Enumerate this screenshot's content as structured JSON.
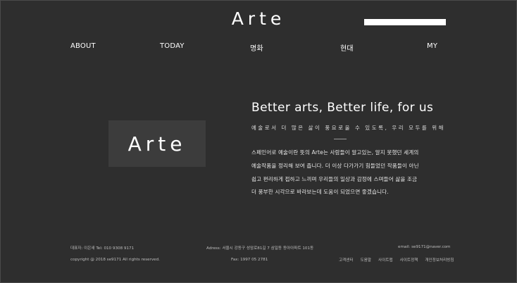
{
  "header": {
    "logo_text": "Arte",
    "search": {
      "value": "",
      "placeholder": ""
    }
  },
  "nav": {
    "items": [
      {
        "label": "ABOUT"
      },
      {
        "label": "TODAY"
      },
      {
        "label": "명화"
      },
      {
        "label": "현대"
      },
      {
        "label": "MY"
      }
    ]
  },
  "hero": {
    "brand_text": "Arte",
    "headline": "Better arts, Better life, for us",
    "subline": "예술로서 더 많은 삶이 풍요로울 수 있도록, 우리 모두를 위해",
    "description": [
      "스페인어로 예술이란 뜻의 Arte는 사람들이 알고있는, 알지 못했던 세계의",
      "예술작품을 정리해 보여 줍니다. 더 이상 다가가기 힘들었던 작품들이 아닌",
      "쉽고 편리하게 접하고 느끼며 우리들의 일상과 감정에 스며들어 삶을 조금",
      "더 풍부한 시각으로 바라보는데 도움이 되었으면 좋겠습니다."
    ]
  },
  "footer": {
    "contact": "대표자: 이은새     Tel: 010 9308 9171",
    "address": "Adress: 서울시 강동구 성암로81길 7 삼일동 동아아파트 101동",
    "email": "email: se9171@naver.com",
    "copyright": "copyright @ 2018 se9171 All rights reserved.",
    "fax": "Fax: 1997 05 2781",
    "links": [
      "고객센터",
      "도움말",
      "사이트맵",
      "사이트정책",
      "개인정보처리방침"
    ]
  }
}
